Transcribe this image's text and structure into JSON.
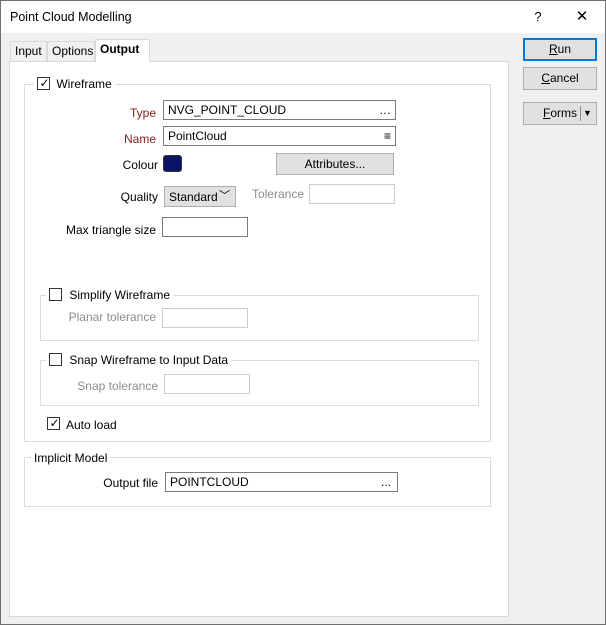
{
  "window": {
    "title": "Point Cloud Modelling",
    "help_glyph": "?",
    "close_glyph": "✕"
  },
  "tabs": [
    {
      "label": "Input"
    },
    {
      "label": "Options"
    },
    {
      "label": "Output",
      "active": true
    }
  ],
  "buttons": {
    "run_prefix": "",
    "run_mnemonic": "R",
    "run_rest": "un",
    "cancel_mnemonic": "C",
    "cancel_rest": "ancel",
    "forms_mnemonic": "F",
    "forms_rest": "orms",
    "forms_arrow": "▼"
  },
  "wireframe": {
    "label": "Wireframe",
    "checked": true,
    "type_label": "Type",
    "type_value": "NVG_POINT_CLOUD",
    "type_icon": "…",
    "name_label": "Name",
    "name_value": "PointCloud",
    "name_icon": "≡",
    "colour_label": "Colour",
    "colour_hex": "#0b1464",
    "attributes_label": "Attributes...",
    "quality_label": "Quality",
    "quality_value": "Standard",
    "tolerance_label": "Tolerance",
    "tolerance_value": "",
    "max_triangle_label": "Max triangle size",
    "max_triangle_value": ""
  },
  "simplify": {
    "label": "Simplify Wireframe",
    "checked": false,
    "planar_label": "Planar tolerance",
    "planar_value": ""
  },
  "snap": {
    "label": "Snap Wireframe to Input Data",
    "checked": false,
    "tolerance_label": "Snap tolerance",
    "tolerance_value": ""
  },
  "auto_load": {
    "label": "Auto load",
    "checked": true
  },
  "implicit_model": {
    "label": "Implicit Model",
    "output_file_label": "Output file",
    "output_file_value": "POINTCLOUD",
    "browse_icon": "..."
  },
  "check_glyph": "✓"
}
